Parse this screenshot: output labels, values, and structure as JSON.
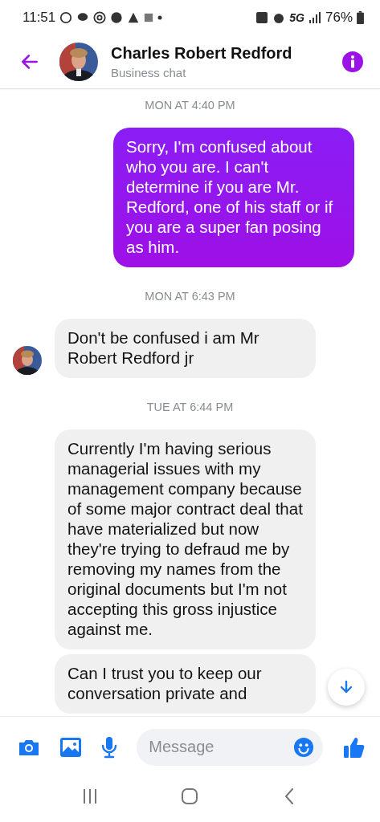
{
  "status_bar": {
    "time": "11:51",
    "network": "5G",
    "battery": "76%"
  },
  "header": {
    "name": "Charles Robert Redford",
    "subtitle": "Business chat"
  },
  "messages": [
    {
      "kind": "timestamp",
      "text": "MON AT 4:40 PM"
    },
    {
      "kind": "sent",
      "text": "Sorry, I'm confused about who you are. I can't determine if you are Mr. Redford,  one of his staff or if you are a super fan posing as him."
    },
    {
      "kind": "timestamp",
      "text": "MON AT 6:43 PM"
    },
    {
      "kind": "received",
      "avatar": true,
      "text": "Don't be confused i am Mr Robert Redford jr"
    },
    {
      "kind": "timestamp",
      "text": "TUE AT 6:44 PM"
    },
    {
      "kind": "received",
      "avatar": false,
      "text": "Currently I'm having serious managerial issues with my management company because of some major contract deal that have materialized but now they're trying to defraud me by removing my names from the original documents but I'm not accepting this gross injustice against me."
    },
    {
      "kind": "received",
      "avatar": false,
      "text": "Can I trust you to keep our conversation private and"
    }
  ],
  "composer": {
    "placeholder": "Message"
  }
}
